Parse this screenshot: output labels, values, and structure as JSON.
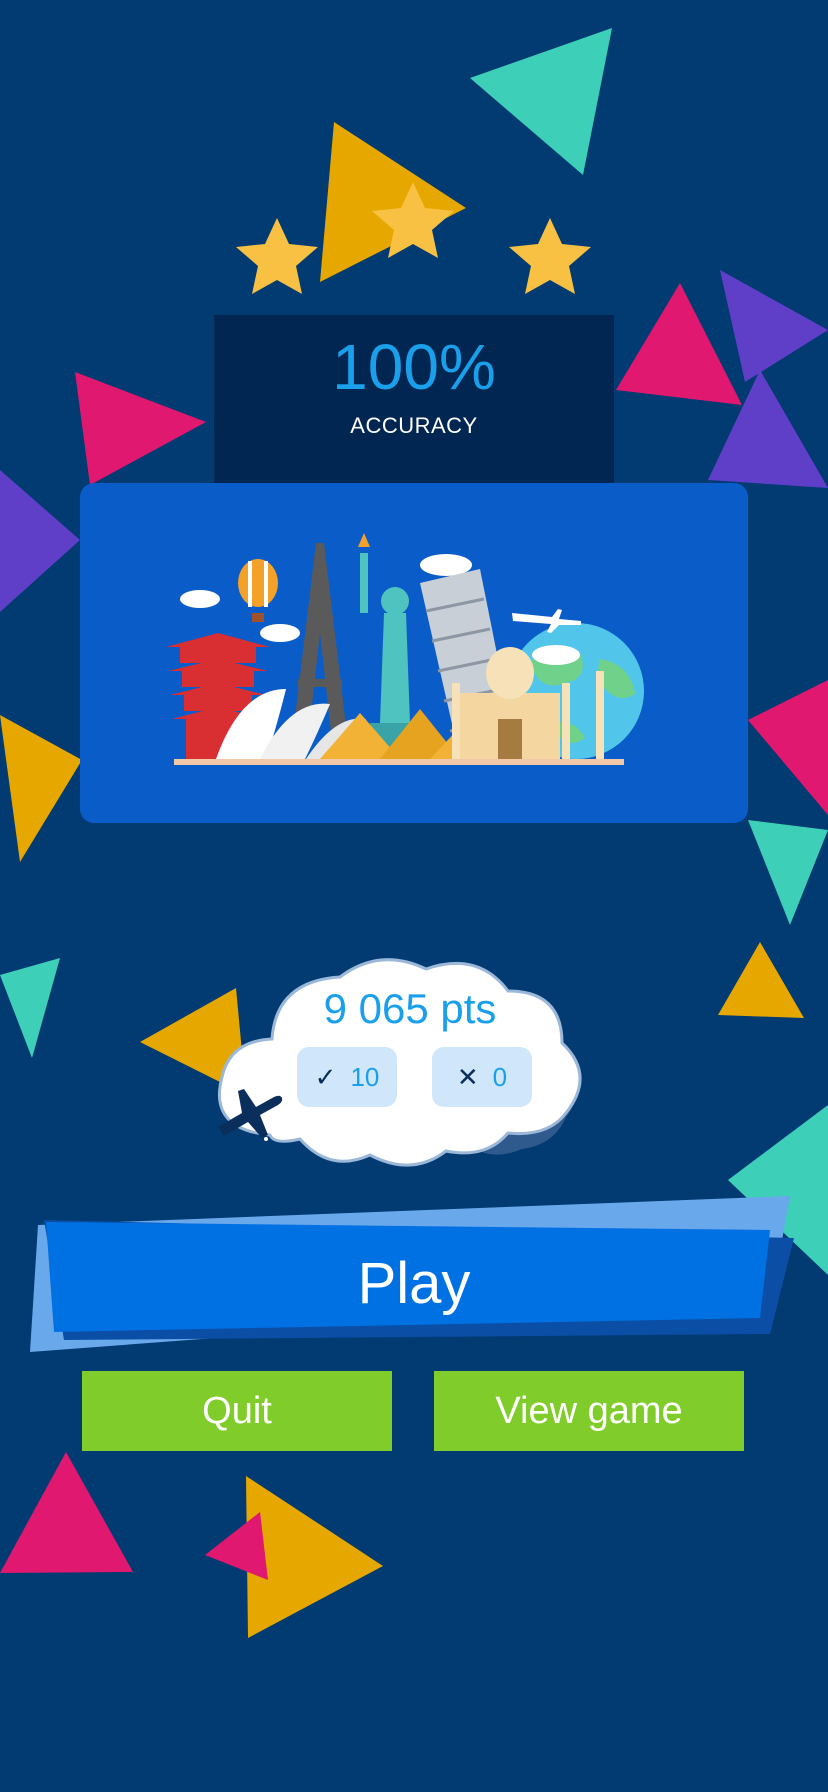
{
  "accuracy": {
    "value": "100%",
    "label": "ACCURACY"
  },
  "rating": {
    "stars": 3
  },
  "score": {
    "points": "9 065 pts",
    "correct": {
      "icon": "check-icon",
      "count": "10"
    },
    "wrong": {
      "icon": "close-icon",
      "count": "0"
    }
  },
  "actions": {
    "play_label": "Play",
    "quit_label": "Quit",
    "view_label": "View game"
  },
  "icons": [
    "star-icon",
    "airplane-icon",
    "landmarks-illustration"
  ],
  "colors": {
    "background": "#023a72",
    "accent_blue": "#1aa0ea",
    "play_button": "#0071e3",
    "secondary_button": "#7fcc2a",
    "star": "#f9c143",
    "panel": "#022652"
  }
}
